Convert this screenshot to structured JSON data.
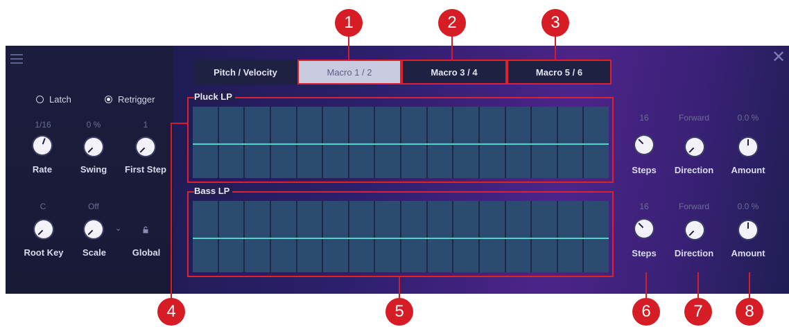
{
  "left": {
    "latch_label": "Latch",
    "retrigger_label": "Retrigger",
    "row1": [
      {
        "value": "1/16",
        "label": "Rate"
      },
      {
        "value": "0 %",
        "label": "Swing"
      },
      {
        "value": "1",
        "label": "First Step"
      }
    ],
    "row2": [
      {
        "value": "C",
        "label": "Root Key"
      },
      {
        "value": "Off",
        "label": "Scale"
      },
      {
        "value": "",
        "label": "Global"
      }
    ]
  },
  "tabs": [
    "Pitch / Velocity",
    "Macro 1 / 2",
    "Macro 3 / 4",
    "Macro 5 / 6"
  ],
  "active_tab": "Macro 1 / 2",
  "lanes": [
    {
      "title": "Pluck LP",
      "steps_value": "16",
      "steps_label": "Steps",
      "direction_value": "Forward",
      "direction_label": "Direction",
      "amount_value": "0.0 %",
      "amount_label": "Amount"
    },
    {
      "title": "Bass LP",
      "steps_value": "16",
      "steps_label": "Steps",
      "direction_value": "Forward",
      "direction_label": "Direction",
      "amount_value": "0.0 %",
      "amount_label": "Amount"
    }
  ],
  "callouts": [
    "1",
    "2",
    "3",
    "4",
    "5",
    "6",
    "7",
    "8"
  ],
  "colors": {
    "callout": "#d61c24",
    "step_cell": "#2c4b71",
    "step_line": "#4fd4c9",
    "active_tab": "#c9cbe0"
  },
  "icons": [
    "menu-icon",
    "close-icon",
    "lock-icon",
    "chevron-down-icon"
  ]
}
